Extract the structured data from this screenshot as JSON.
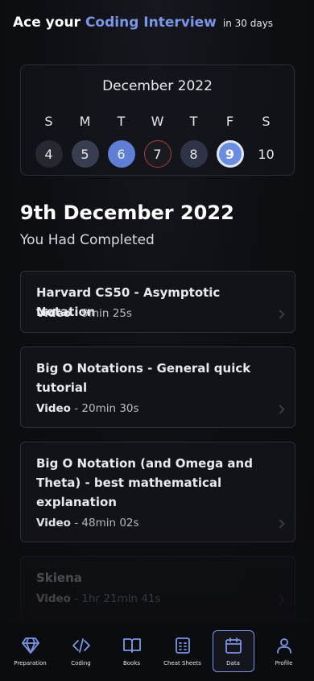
{
  "header": {
    "prefix": "Ace your",
    "highlight": "Coding Interview",
    "suffix": "in 30 days"
  },
  "calendar": {
    "month_label": "December 2022",
    "weekdays": [
      "S",
      "M",
      "T",
      "W",
      "T",
      "F",
      "S"
    ],
    "days": [
      "4",
      "5",
      "6",
      "7",
      "8",
      "9",
      "10"
    ],
    "selected_day": "9"
  },
  "selected_date_heading": "9th December 2022",
  "completed_label": "You Had Completed",
  "items": [
    {
      "title": "Harvard CS50 - Asymptotic Notation",
      "type": "Video",
      "duration": "9min 25s"
    },
    {
      "title": "Big O Notations - General quick tutorial",
      "type": "Video",
      "duration": "20min 30s"
    },
    {
      "title": "Big O Notation (and Omega and Theta) - best mathematical explanation",
      "type": "Video",
      "duration": "48min 02s"
    },
    {
      "title": "Skiena",
      "type": "Video",
      "duration": "1hr 21min 41s"
    }
  ],
  "nav": [
    {
      "label": "Preparation",
      "icon": "diamond-icon"
    },
    {
      "label": "Coding",
      "icon": "code-icon"
    },
    {
      "label": "Books",
      "icon": "book-icon"
    },
    {
      "label": "Cheat Sheets",
      "icon": "document-icon"
    },
    {
      "label": "Data",
      "icon": "calendar-icon"
    },
    {
      "label": "Profile",
      "icon": "user-icon"
    }
  ],
  "active_nav": "Data",
  "colors": {
    "accent": "#7b96e6",
    "background": "#0d0e12",
    "missed_day": "#b53a3a"
  }
}
